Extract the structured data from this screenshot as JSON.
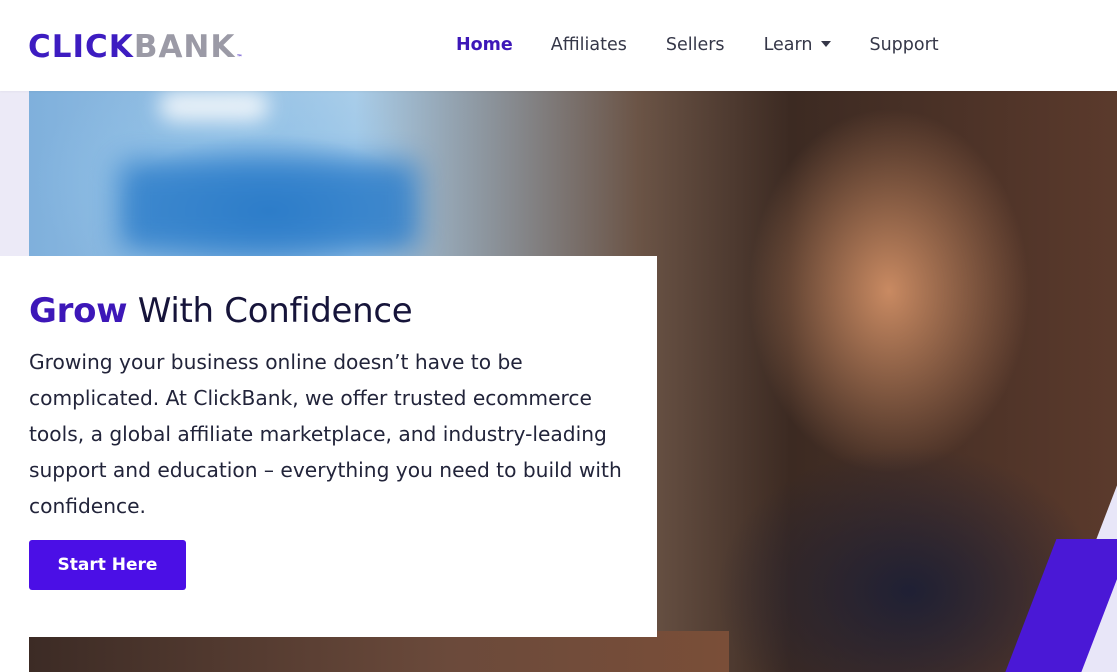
{
  "brand": {
    "logo_click": "CLICK",
    "logo_bank": "BANK",
    "logo_tm": "™"
  },
  "nav": {
    "items": [
      {
        "label": "Home",
        "active": true
      },
      {
        "label": "Affiliates",
        "active": false
      },
      {
        "label": "Sellers",
        "active": false
      },
      {
        "label": "Learn",
        "active": false,
        "has_dropdown": true
      },
      {
        "label": "Support",
        "active": false
      }
    ]
  },
  "hero": {
    "headline_accent": "Grow",
    "headline_rest": " With Confidence",
    "body": "Growing your business online doesn’t have to be complicated. At ClickBank, we offer trusted ecommerce tools, a global affiliate marketplace, and industry-leading support and education – everything you need to build with confidence.",
    "cta_label": "Start Here"
  },
  "colors": {
    "brand_purple": "#3d17b8",
    "cta_purple": "#4b0fe6",
    "logo_gray": "#9b9aa6",
    "text_dark": "#16143a"
  }
}
